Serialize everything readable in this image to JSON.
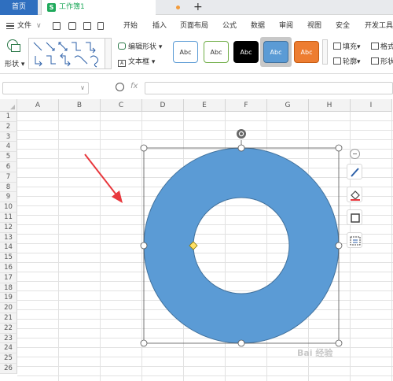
{
  "tabs": {
    "home": "首页",
    "doc_icon": "S",
    "doc_name": "工作簿1"
  },
  "menu": {
    "file": "文件",
    "items": [
      "开始",
      "插入",
      "页面布局",
      "公式",
      "数据",
      "审阅",
      "视图",
      "安全",
      "开发工具"
    ]
  },
  "ribbon": {
    "shapes_label": "形状",
    "edit_shape": "编辑形状",
    "text_box": "文本框",
    "style_label": "Abc",
    "fill": "填充",
    "outline": "轮廓",
    "format": "格式",
    "shape_effects": "形状"
  },
  "formula_bar": {
    "fx": "fx",
    "name_value": "",
    "formula_value": ""
  },
  "columns": [
    "A",
    "B",
    "C",
    "D",
    "E",
    "F",
    "G",
    "H",
    "I"
  ],
  "rows": [
    "1",
    "2",
    "3",
    "4",
    "5",
    "6",
    "7",
    "8",
    "9",
    "10",
    "11",
    "12",
    "13",
    "14",
    "15",
    "16",
    "17",
    "18",
    "19",
    "20",
    "21",
    "22",
    "23",
    "24",
    "25",
    "26"
  ],
  "shape": {
    "type": "donut",
    "fill": "#5b9bd5",
    "outline": "#41719c"
  },
  "annotation": {
    "arrow_color": "#e8383d"
  },
  "colors": {
    "accent_blue": "#2f6fbf",
    "sheet_green": "#1fa95b",
    "orange_style": "#ed7d31",
    "black_style": "#000000",
    "blue_style": "#5b9bd5"
  },
  "watermark": "Bai 经验"
}
